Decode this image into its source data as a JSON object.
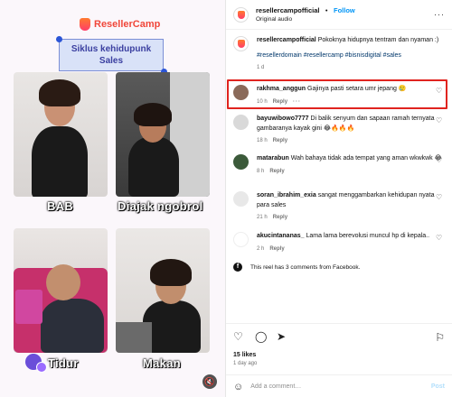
{
  "media": {
    "brand": "ResellerCamp",
    "banner_line1": "Siklus kehidupunk",
    "banner_line2": "Sales",
    "captions": [
      "BAB",
      "Diajak ngobrol",
      "Tidur",
      "Makan"
    ],
    "mute_icon": "mute-icon"
  },
  "post_header": {
    "username": "resellercampofficial",
    "separator": "•",
    "follow_label": "Follow",
    "audio": "Original audio",
    "more": "···"
  },
  "caption": {
    "username": "resellercampofficial",
    "text": "Pokoknya hidupnya tentram dan nyaman :)",
    "hashtags": "#resellerdomain #resellercamp #bisnisdigital #sales",
    "time": "1 d"
  },
  "comments": [
    {
      "username": "rakhma_anggun",
      "text": "Gajinya pasti setara umr jepang 🥲",
      "time": "10 h",
      "reply": "Reply",
      "more": "···",
      "avatar_color": "#8a6a5a"
    },
    {
      "username": "bayuwibowo7777",
      "text": "Di balik senyum dan sapaan ramah ternyata gambaranya kayak gini 😂🔥🔥🔥",
      "time": "18 h",
      "reply": "Reply",
      "avatar_color": "#d9d9d9"
    },
    {
      "username": "matarabun",
      "text": "Wah bahaya tidak ada tempat yang aman wkwkwk 😂",
      "time": "8 h",
      "reply": "Reply",
      "avatar_color": "#3b5a3a"
    },
    {
      "username": "soran_ibrahim_exia",
      "text": "sangat menggambarkan kehidupan nyata para sales",
      "time": "21 h",
      "reply": "Reply",
      "avatar_color": "#e8e8e8"
    },
    {
      "username": "akucintananas_",
      "text": "Lama lama berevolusi muncul hp di kepala..",
      "time": "2 h",
      "reply": "Reply",
      "avatar_color": "#ffffff"
    }
  ],
  "facebook_note": "This reel has 3 comments from Facebook.",
  "actions": {
    "likes": "15 likes",
    "ago": "1 day ago",
    "comment_placeholder": "Add a comment…",
    "post_label": "Post"
  },
  "colors": {
    "follow": "#0095f6",
    "highlight": "#e0241f",
    "brand": "#f0473a"
  }
}
